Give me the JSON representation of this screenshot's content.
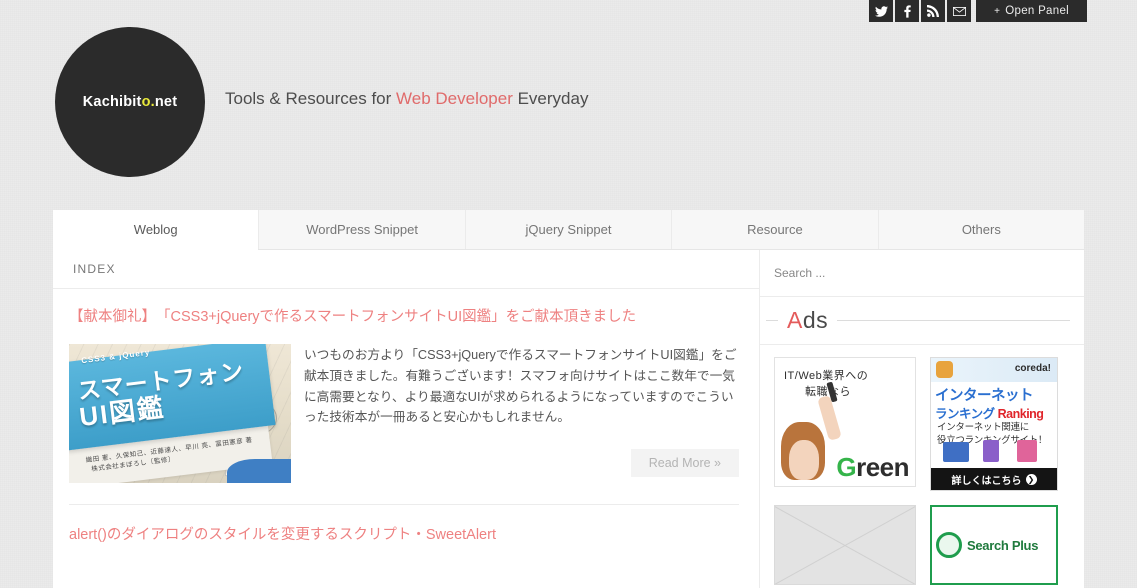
{
  "topbar": {
    "social": [
      {
        "name": "twitter-icon",
        "label": "Twitter"
      },
      {
        "name": "facebook-icon",
        "label": "Facebook"
      },
      {
        "name": "rss-icon",
        "label": "RSS"
      },
      {
        "name": "mail-icon",
        "label": "Mail"
      }
    ],
    "open_panel_plus": "+",
    "open_panel_label": "Open Panel"
  },
  "header": {
    "logo": {
      "pre": "Kachibit",
      "accent": "o.",
      "post": "net"
    },
    "tagline": {
      "pre": "Tools & Resources for ",
      "highlight": "Web Developer",
      "post": " Everyday"
    }
  },
  "nav": {
    "tabs": [
      {
        "label": "Weblog",
        "active": true
      },
      {
        "label": "WordPress Snippet",
        "active": false
      },
      {
        "label": "jQuery Snippet",
        "active": false
      },
      {
        "label": "Resource",
        "active": false
      },
      {
        "label": "Others",
        "active": false
      }
    ]
  },
  "content": {
    "breadcrumb": "INDEX",
    "articles": [
      {
        "title": "【献本御礼】　「CSS3+jQueryで作るスマートフォンサイトUI図鑑」をご献本頂きました",
        "excerpt": "いつものお方より「CSS3+jQueryで作るスマートフォンサイトUI図鑑」をご献本頂きました。有難うございます！スマフォ向けサイトはここ数年で一気に高需要となり、より最適なUIが求められるようになっていますのでこういった技術本が一冊あると安心かもしれません。",
        "read_more": "Read More »",
        "thumbnail": {
          "alt": "book-cover-photo",
          "line1": "CSS3 & jQuery",
          "line2": "スマートフォン",
          "line3": "UI図鑑",
          "line4": "織田 憲、久保知己、近藤達人、早川 亮、冨田憲彦 著",
          "line5": "株式会社まぼろし〔監修〕"
        }
      },
      {
        "title": "alert()のダイアログのスタイルを変更するスクリプト・SweetAlert"
      }
    ]
  },
  "sidebar": {
    "search_placeholder": "Search ...",
    "search_value": "",
    "ads_title": {
      "first": "A",
      "rest": "ds"
    },
    "ads": [
      {
        "name": "green-ad",
        "line1": "IT/Web業界への",
        "line2": "転職なら",
        "logo_g": "G",
        "logo_rest": "reen"
      },
      {
        "name": "coreda-ad",
        "brand": "coreda!",
        "line1": "インターネット",
        "line2_jp": "ランキング",
        "line2_en": "Ranking",
        "line3": "インターネット関連に\n役立つランキングサイト！",
        "cta": "詳しくはこちら",
        "cta_arrow": "❯"
      },
      {
        "name": "placeholder-ad",
        "alt": "broken-image-placeholder"
      },
      {
        "name": "search-plus-ad",
        "label": "Search Plus"
      }
    ]
  },
  "colors": {
    "accent_red": "#e06b6b",
    "link_red": "#ee8181",
    "logo_yellow": "#e8e83a",
    "dark": "#2b2b2b",
    "page_bg": "#ebebeb",
    "green": "#35b44a"
  }
}
